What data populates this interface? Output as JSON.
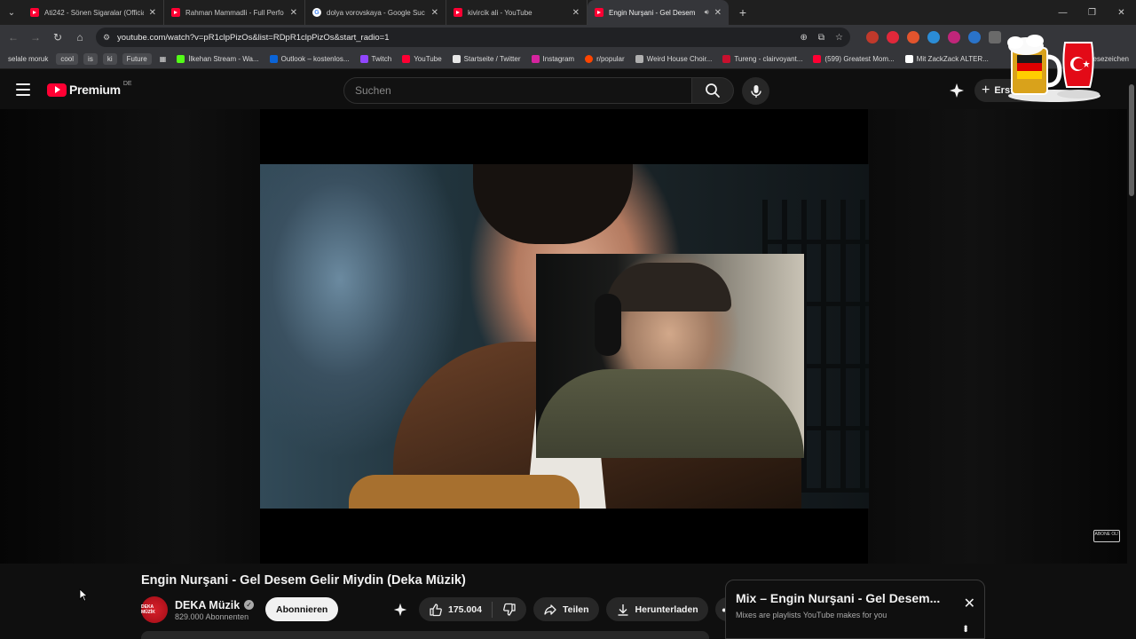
{
  "browser": {
    "tabs": [
      {
        "title": "Ati242 - Sönen Sigaralar (Official",
        "icon": "youtube-favicon"
      },
      {
        "title": "Rahman Mammadli - Full Perfo",
        "icon": "youtube-favicon"
      },
      {
        "title": "dolya vorovskaya - Google Suc",
        "icon": "google-favicon"
      },
      {
        "title": "kivircik ali - YouTube",
        "icon": "youtube-favicon"
      },
      {
        "title": "Engin Nurşani - Gel Desem",
        "icon": "youtube-favicon",
        "active": true
      }
    ],
    "url": "youtube.com/watch?v=pR1clpPizOs&list=RDpR1clpPizOs&start_radio=1",
    "bookmarks": [
      {
        "label": "selale moruk",
        "chip": true
      },
      {
        "label": "cool",
        "chip": true
      },
      {
        "label": "is",
        "chip": true
      },
      {
        "label": "ki",
        "chip": true
      },
      {
        "label": "Future",
        "chip": true
      },
      {
        "label": "İlkehan Stream - Wa...",
        "icon_color": "#53fc18"
      },
      {
        "label": "Outlook – kostenlos...",
        "icon_color": "#0a64d8"
      },
      {
        "label": "Twitch",
        "icon_color": "#9146ff"
      },
      {
        "label": "YouTube",
        "icon_color": "#ff0033"
      },
      {
        "label": "Startseite / Twitter",
        "icon_color": "#e7e7e7"
      },
      {
        "label": "Instagram",
        "icon_color": "#d6249f"
      },
      {
        "label": "r/popular",
        "icon_color": "#ff4500"
      },
      {
        "label": "Weird House Choir...",
        "icon_color": "#b0b0b0"
      },
      {
        "label": "Tureng - clairvoyant...",
        "icon_color": "#c8102e"
      },
      {
        "label": "(599) Greatest Mom...",
        "icon_color": "#ff0033"
      },
      {
        "label": "Mit ZackZack ALTER...",
        "icon_color": "#ffffff"
      }
    ],
    "bookmarks_right": "Lesezeichen"
  },
  "youtube": {
    "brand": "Premium",
    "region": "DE",
    "search_placeholder": "Suchen",
    "create_label": "Erstellen"
  },
  "video": {
    "title": "Engin Nurşani - Gel Desem Gelir Miydin (Deka Müzik)",
    "overlay_badge": "ABONE OL!",
    "channel": {
      "name": "DEKA Müzik",
      "avatar_text": "DEKA MÜZİK",
      "subscribers": "829.000 Abonnenten",
      "subscribe_label": "Abonnieren"
    },
    "actions": {
      "likes": "175.004",
      "share": "Teilen",
      "download": "Herunterladen"
    }
  },
  "mix": {
    "title": "Mix – Engin Nurşani - Gel Desem...",
    "subtitle": "Mixes are playlists YouTube makes for you"
  },
  "colors": {
    "youtube_red": "#ff0033",
    "background": "#0f0f0f",
    "chip": "#272727"
  }
}
